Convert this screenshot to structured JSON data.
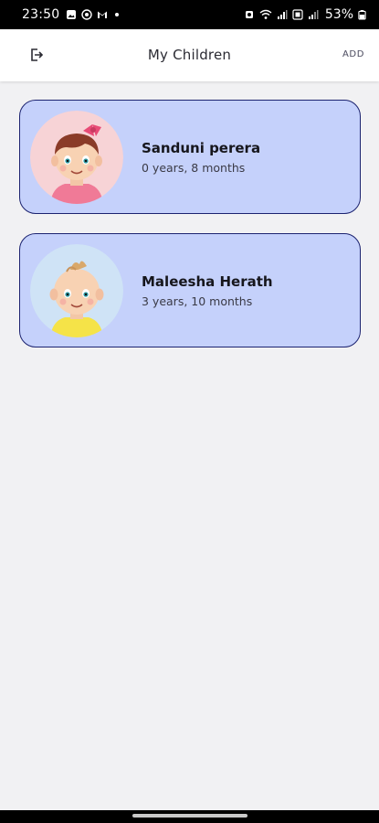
{
  "status_bar": {
    "time": "23:50",
    "battery": "53%"
  },
  "app_bar": {
    "title": "My Children",
    "add_label": "ADD"
  },
  "children": [
    {
      "name": "Sanduni perera",
      "age": "0 years, 8 months",
      "avatar": "baby-girl-avatar"
    },
    {
      "name": "Maleesha Herath",
      "age": "3 years, 10 months",
      "avatar": "baby-boy-avatar"
    }
  ],
  "colors": {
    "card_bg": "#c5d1fb",
    "card_border": "#1c2370",
    "page_bg": "#f1f1f3"
  }
}
